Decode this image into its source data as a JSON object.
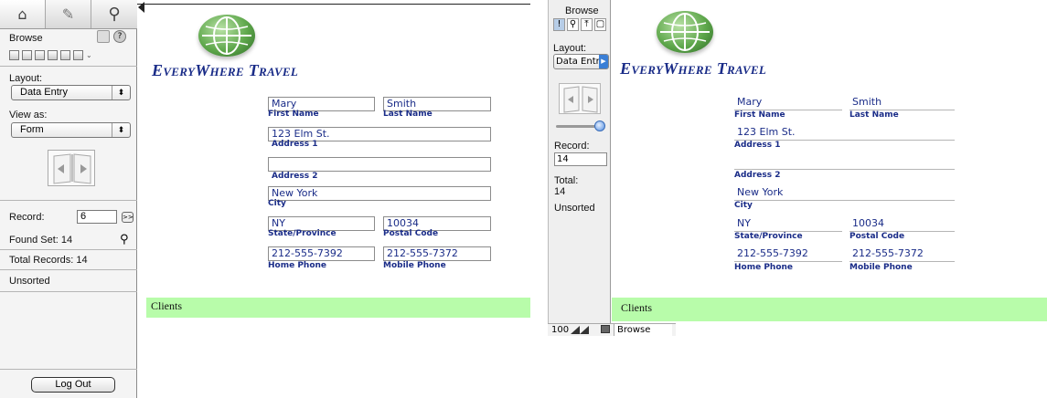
{
  "left": {
    "tabs": [
      {
        "name": "home-icon",
        "glyph": "⌂"
      },
      {
        "name": "pencil-icon",
        "glyph": "✎"
      },
      {
        "name": "magnifier-icon",
        "glyph": "⚲"
      }
    ],
    "mode_label": "Browse",
    "layout_label": "Layout:",
    "layout_value": "Data Entry",
    "viewas_label": "View as:",
    "viewas_value": "Form",
    "record_label": "Record:",
    "record_value": "6",
    "record_go": ">>",
    "found_set": "Found Set: 14",
    "total_records": "Total Records: 14",
    "sort_status": "Unsorted",
    "logout_label": "Log Out"
  },
  "right": {
    "mode_label": "Browse",
    "mode_icons": [
      "!",
      "⚲",
      "⤒",
      "▢"
    ],
    "layout_label": "Layout:",
    "layout_value": "Data Entry",
    "record_label": "Record:",
    "record_value": "14",
    "total_label": "Total:",
    "total_value": "14",
    "sort_status": "Unsorted",
    "zoom": "100",
    "mode_status": "Browse"
  },
  "form": {
    "company_name_initial1": "E",
    "company_name_rest1": "VERY",
    "company_name_initial2": "W",
    "company_name_rest2": "HERE",
    "company_name_initial3": "T",
    "company_name_rest3": "RAVEL",
    "first_name": "Mary",
    "first_name_label": "First Name",
    "last_name": "Smith",
    "last_name_label": "Last Name",
    "address1": "123 Elm St.",
    "address1_label": "Address 1",
    "address2": "",
    "address2_label": "Address 2",
    "city": "New York",
    "city_label": "City",
    "state": "NY",
    "state_label": "State/Province",
    "postal": "10034",
    "postal_label": "Postal Code",
    "home_phone": "212-555-7392",
    "home_phone_label": "Home Phone",
    "mobile_phone": "212-555-7372",
    "mobile_phone_label": "Mobile Phone",
    "footer_label": "Clients"
  },
  "colors": {
    "footer_bar": "#b8fcaa",
    "label_blue": "#1a2c88"
  }
}
